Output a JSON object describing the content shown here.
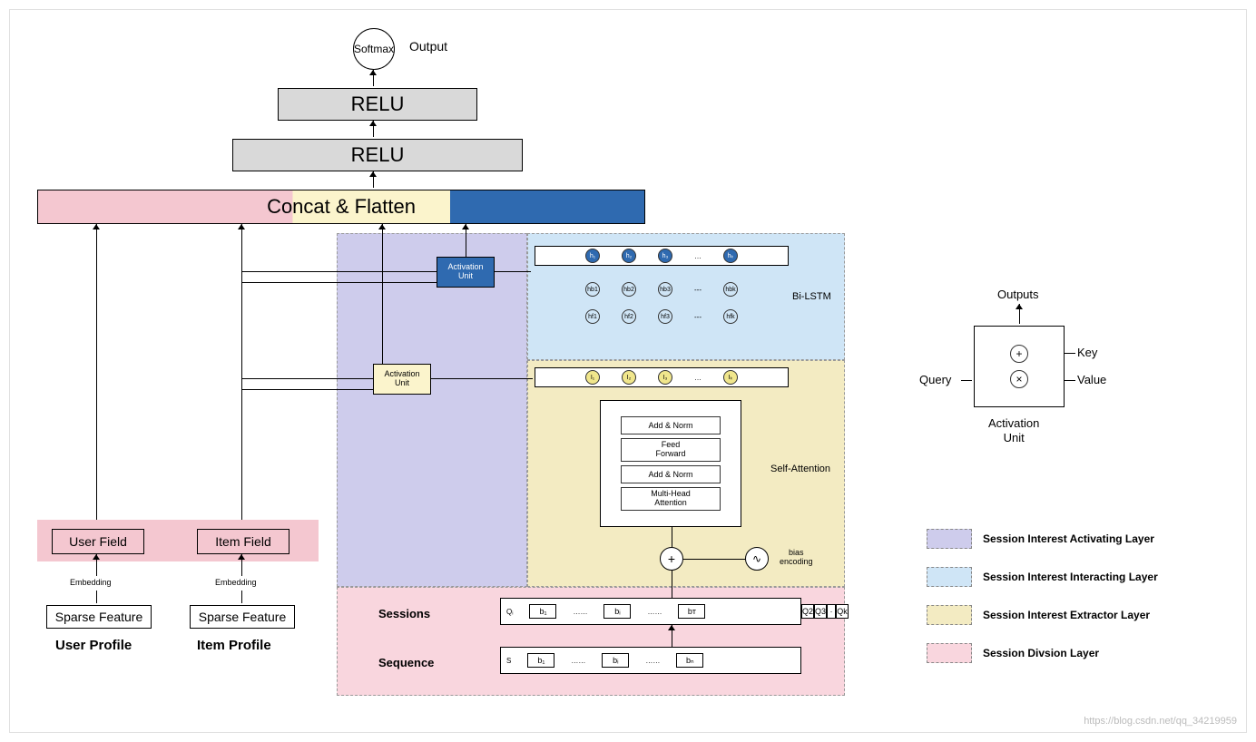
{
  "output": {
    "softmax": "Softmax",
    "label": "Output"
  },
  "relu1": "RELU",
  "relu2": "RELU",
  "concat": "Concat & Flatten",
  "act_unit1": "Activation\nUnit",
  "act_unit2": "Activation\nUnit",
  "user_field": "User Field",
  "item_field": "Item Field",
  "embed": "Embedding",
  "sparse": "Sparse Feature",
  "user_profile": "User Profile",
  "item_profile": "Item Profile",
  "bilstm": "Bi-LSTM",
  "self_attn": "Self-Attention",
  "bias_enc": "bias\nencoding",
  "sessions": "Sessions",
  "sequence": "Sequence",
  "sa": {
    "addnorm": "Add & Norm",
    "ff": "Feed\nForward",
    "mha": "Multi-Head\nAttention"
  },
  "h_nodes": [
    "h₁",
    "h₂",
    "h₃",
    "…",
    "hₖ"
  ],
  "hb_nodes": [
    "hb1",
    "hb2",
    "hb3",
    "hbk"
  ],
  "hf_nodes": [
    "hf1",
    "hf2",
    "hf3",
    "hfk"
  ],
  "i_nodes": [
    "I₁",
    "I₂",
    "I₃",
    "…",
    "Iₖ"
  ],
  "seq": {
    "q_label": "Qᵢ",
    "s_label": "S",
    "b_i": [
      "b₁",
      "……",
      "bᵢ",
      "……",
      "bᴛ"
    ],
    "b_n": [
      "b₁",
      "……",
      "bᵢ",
      "……",
      "bₙ"
    ],
    "q_tail": [
      "Q2",
      "Q3",
      "·",
      "Qk"
    ]
  },
  "au": {
    "outputs": "Outputs",
    "key": "Key",
    "query": "Query",
    "value": "Value",
    "label": "Activation\nUnit",
    "plus": "+",
    "times": "×"
  },
  "legend": {
    "activating": "Session Interest Activating Layer",
    "interacting": "Session Interest Interacting Layer",
    "extractor": "Session Interest Extractor Layer",
    "division": "Session Divsion Layer"
  },
  "watermark": "https://blog.csdn.net/qq_34219959"
}
